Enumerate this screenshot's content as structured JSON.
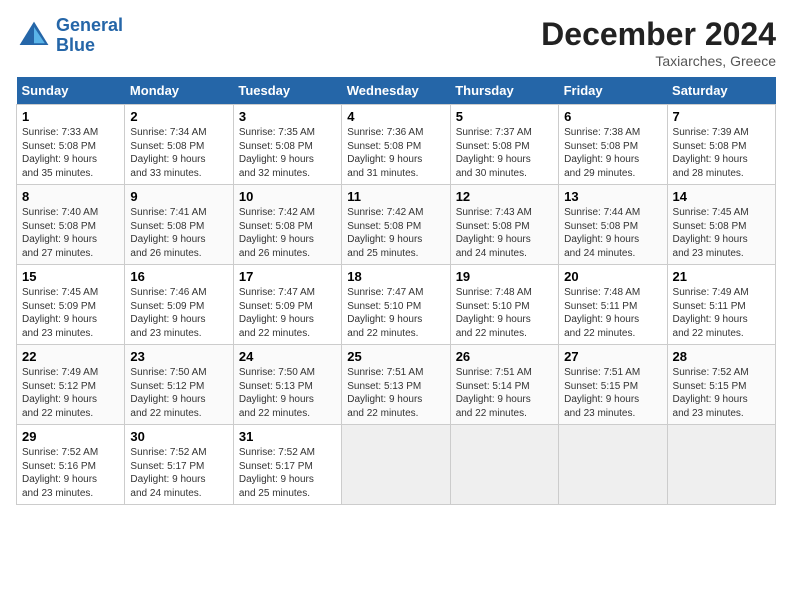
{
  "header": {
    "logo": {
      "line1": "General",
      "line2": "Blue"
    },
    "title": "December 2024",
    "location": "Taxiarches, Greece"
  },
  "weekdays": [
    "Sunday",
    "Monday",
    "Tuesday",
    "Wednesday",
    "Thursday",
    "Friday",
    "Saturday"
  ],
  "weeks": [
    [
      {
        "day": 1,
        "info": "Sunrise: 7:33 AM\nSunset: 5:08 PM\nDaylight: 9 hours\nand 35 minutes."
      },
      {
        "day": 2,
        "info": "Sunrise: 7:34 AM\nSunset: 5:08 PM\nDaylight: 9 hours\nand 33 minutes."
      },
      {
        "day": 3,
        "info": "Sunrise: 7:35 AM\nSunset: 5:08 PM\nDaylight: 9 hours\nand 32 minutes."
      },
      {
        "day": 4,
        "info": "Sunrise: 7:36 AM\nSunset: 5:08 PM\nDaylight: 9 hours\nand 31 minutes."
      },
      {
        "day": 5,
        "info": "Sunrise: 7:37 AM\nSunset: 5:08 PM\nDaylight: 9 hours\nand 30 minutes."
      },
      {
        "day": 6,
        "info": "Sunrise: 7:38 AM\nSunset: 5:08 PM\nDaylight: 9 hours\nand 29 minutes."
      },
      {
        "day": 7,
        "info": "Sunrise: 7:39 AM\nSunset: 5:08 PM\nDaylight: 9 hours\nand 28 minutes."
      }
    ],
    [
      {
        "day": 8,
        "info": "Sunrise: 7:40 AM\nSunset: 5:08 PM\nDaylight: 9 hours\nand 27 minutes."
      },
      {
        "day": 9,
        "info": "Sunrise: 7:41 AM\nSunset: 5:08 PM\nDaylight: 9 hours\nand 26 minutes."
      },
      {
        "day": 10,
        "info": "Sunrise: 7:42 AM\nSunset: 5:08 PM\nDaylight: 9 hours\nand 26 minutes."
      },
      {
        "day": 11,
        "info": "Sunrise: 7:42 AM\nSunset: 5:08 PM\nDaylight: 9 hours\nand 25 minutes."
      },
      {
        "day": 12,
        "info": "Sunrise: 7:43 AM\nSunset: 5:08 PM\nDaylight: 9 hours\nand 24 minutes."
      },
      {
        "day": 13,
        "info": "Sunrise: 7:44 AM\nSunset: 5:08 PM\nDaylight: 9 hours\nand 24 minutes."
      },
      {
        "day": 14,
        "info": "Sunrise: 7:45 AM\nSunset: 5:08 PM\nDaylight: 9 hours\nand 23 minutes."
      }
    ],
    [
      {
        "day": 15,
        "info": "Sunrise: 7:45 AM\nSunset: 5:09 PM\nDaylight: 9 hours\nand 23 minutes."
      },
      {
        "day": 16,
        "info": "Sunrise: 7:46 AM\nSunset: 5:09 PM\nDaylight: 9 hours\nand 23 minutes."
      },
      {
        "day": 17,
        "info": "Sunrise: 7:47 AM\nSunset: 5:09 PM\nDaylight: 9 hours\nand 22 minutes."
      },
      {
        "day": 18,
        "info": "Sunrise: 7:47 AM\nSunset: 5:10 PM\nDaylight: 9 hours\nand 22 minutes."
      },
      {
        "day": 19,
        "info": "Sunrise: 7:48 AM\nSunset: 5:10 PM\nDaylight: 9 hours\nand 22 minutes."
      },
      {
        "day": 20,
        "info": "Sunrise: 7:48 AM\nSunset: 5:11 PM\nDaylight: 9 hours\nand 22 minutes."
      },
      {
        "day": 21,
        "info": "Sunrise: 7:49 AM\nSunset: 5:11 PM\nDaylight: 9 hours\nand 22 minutes."
      }
    ],
    [
      {
        "day": 22,
        "info": "Sunrise: 7:49 AM\nSunset: 5:12 PM\nDaylight: 9 hours\nand 22 minutes."
      },
      {
        "day": 23,
        "info": "Sunrise: 7:50 AM\nSunset: 5:12 PM\nDaylight: 9 hours\nand 22 minutes."
      },
      {
        "day": 24,
        "info": "Sunrise: 7:50 AM\nSunset: 5:13 PM\nDaylight: 9 hours\nand 22 minutes."
      },
      {
        "day": 25,
        "info": "Sunrise: 7:51 AM\nSunset: 5:13 PM\nDaylight: 9 hours\nand 22 minutes."
      },
      {
        "day": 26,
        "info": "Sunrise: 7:51 AM\nSunset: 5:14 PM\nDaylight: 9 hours\nand 22 minutes."
      },
      {
        "day": 27,
        "info": "Sunrise: 7:51 AM\nSunset: 5:15 PM\nDaylight: 9 hours\nand 23 minutes."
      },
      {
        "day": 28,
        "info": "Sunrise: 7:52 AM\nSunset: 5:15 PM\nDaylight: 9 hours\nand 23 minutes."
      }
    ],
    [
      {
        "day": 29,
        "info": "Sunrise: 7:52 AM\nSunset: 5:16 PM\nDaylight: 9 hours\nand 23 minutes."
      },
      {
        "day": 30,
        "info": "Sunrise: 7:52 AM\nSunset: 5:17 PM\nDaylight: 9 hours\nand 24 minutes."
      },
      {
        "day": 31,
        "info": "Sunrise: 7:52 AM\nSunset: 5:17 PM\nDaylight: 9 hours\nand 25 minutes."
      },
      null,
      null,
      null,
      null
    ]
  ]
}
